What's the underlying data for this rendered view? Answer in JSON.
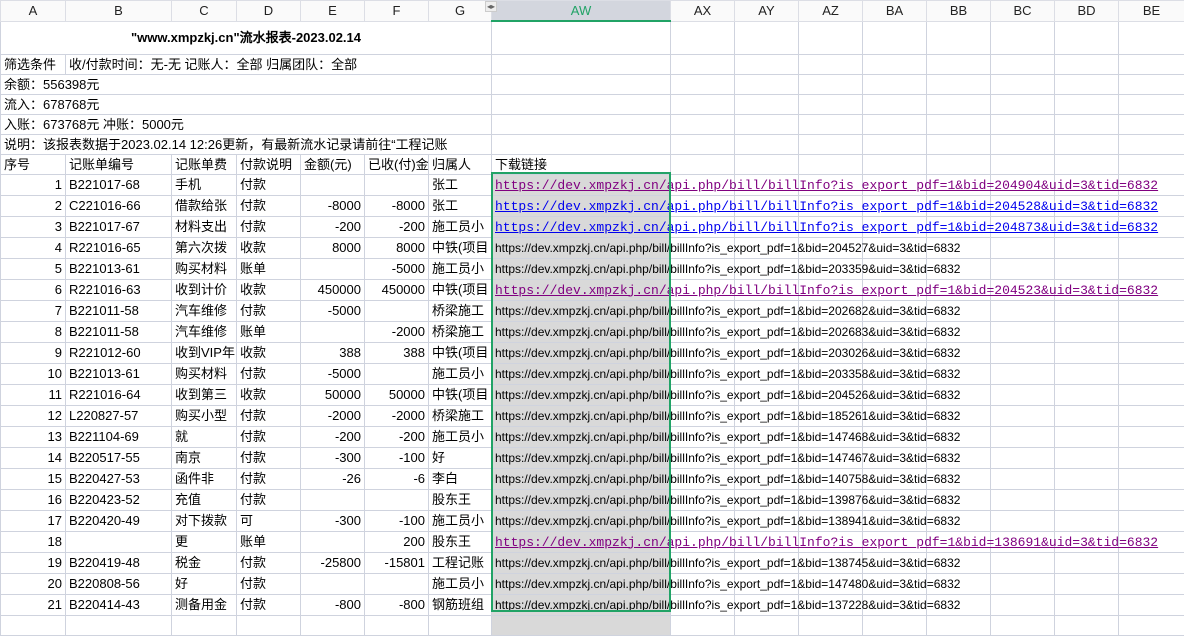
{
  "columns": [
    "A",
    "B",
    "C",
    "D",
    "E",
    "F",
    "G",
    "AW",
    "AX",
    "AY",
    "AZ",
    "BA",
    "BB",
    "BC",
    "BD",
    "BE"
  ],
  "selected_column": "AW",
  "title": "\"www.xmpzkj.cn\"流水报表-2023.02.14",
  "filter_label": "筛选条件",
  "filter_text": "收/付款时间：无-无      记账人：全部     归属团队：全部",
  "balance": "余额：556398元",
  "inflow": "流入：678768元",
  "posted": "入账：673768元      冲账：5000元",
  "note": "说明：该报表数据于2023.02.14 12:26更新，有最新流水记录请前往“工程记账",
  "headers": [
    "序号",
    "记账单编号",
    "记账单费",
    "付款说明",
    "金额(元)",
    "已收(付)金",
    "归属人",
    "下载链接"
  ],
  "url_prefix": "https://dev.xmpzkj.cn/api.php/bill/billInfo?is_export_pdf=1&bid=",
  "rows": [
    {
      "no": "1",
      "code": "B221017-68",
      "item": "手机",
      "desc": "付款",
      "amount": "",
      "paid": "",
      "owner": "张工",
      "url": "https://dev.xmpzkj.cn/api.php/bill/billInfo?is_export_pdf=1&bid=204904&uid=3&tid=6832",
      "link": "visited"
    },
    {
      "no": "2",
      "code": "C221016-66",
      "item": "借款给张",
      "desc": "付款",
      "amount": "-8000",
      "paid": "-8000",
      "owner": "张工",
      "url": "https://dev.xmpzkj.cn/api.php/bill/billInfo?is_export_pdf=1&bid=204528&uid=3&tid=6832",
      "link": "unvisited"
    },
    {
      "no": "3",
      "code": "B221017-67",
      "item": "材料支出",
      "desc": "付款",
      "amount": "-200",
      "paid": "-200",
      "owner": "施工员小",
      "url": "https://dev.xmpzkj.cn/api.php/bill/billInfo?is_export_pdf=1&bid=204873&uid=3&tid=6832",
      "link": "unvisited"
    },
    {
      "no": "4",
      "code": "R221016-65",
      "item": "第六次拨",
      "desc": "收款",
      "amount": "8000",
      "paid": "8000",
      "owner": "中铁(项目",
      "url": "https://dev.xmpzkj.cn/api.php/bill/billInfo?is_export_pdf=1&bid=204527&uid=3&tid=6832",
      "link": "none"
    },
    {
      "no": "5",
      "code": "B221013-61",
      "item": "购买材料",
      "desc": "账单",
      "amount": "",
      "paid": "-5000",
      "owner": "施工员小",
      "url": "https://dev.xmpzkj.cn/api.php/bill/billInfo?is_export_pdf=1&bid=203359&uid=3&tid=6832",
      "link": "none"
    },
    {
      "no": "6",
      "code": "R221016-63",
      "item": "收到计价",
      "desc": "收款",
      "amount": "450000",
      "paid": "450000",
      "owner": "中铁(项目",
      "url": "https://dev.xmpzkj.cn/api.php/bill/billInfo?is_export_pdf=1&bid=204523&uid=3&tid=6832",
      "link": "visited"
    },
    {
      "no": "7",
      "code": "B221011-58",
      "item": "汽车维修",
      "desc": "付款",
      "amount": "-5000",
      "paid": "",
      "owner": "桥梁施工",
      "url": "https://dev.xmpzkj.cn/api.php/bill/billInfo?is_export_pdf=1&bid=202682&uid=3&tid=6832",
      "link": "none"
    },
    {
      "no": "8",
      "code": "B221011-58",
      "item": "汽车维修",
      "desc": "账单",
      "amount": "",
      "paid": "-2000",
      "owner": "桥梁施工",
      "url": "https://dev.xmpzkj.cn/api.php/bill/billInfo?is_export_pdf=1&bid=202683&uid=3&tid=6832",
      "link": "none"
    },
    {
      "no": "9",
      "code": "R221012-60",
      "item": "收到VIP年",
      "desc": "收款",
      "amount": "388",
      "paid": "388",
      "owner": "中铁(项目",
      "url": "https://dev.xmpzkj.cn/api.php/bill/billInfo?is_export_pdf=1&bid=203026&uid=3&tid=6832",
      "link": "none"
    },
    {
      "no": "10",
      "code": "B221013-61",
      "item": "购买材料",
      "desc": "付款",
      "amount": "-5000",
      "paid": "",
      "owner": "施工员小",
      "url": "https://dev.xmpzkj.cn/api.php/bill/billInfo?is_export_pdf=1&bid=203358&uid=3&tid=6832",
      "link": "none"
    },
    {
      "no": "11",
      "code": "R221016-64",
      "item": "收到第三",
      "desc": "收款",
      "amount": "50000",
      "paid": "50000",
      "owner": "中铁(项目",
      "url": "https://dev.xmpzkj.cn/api.php/bill/billInfo?is_export_pdf=1&bid=204526&uid=3&tid=6832",
      "link": "none"
    },
    {
      "no": "12",
      "code": "L220827-57",
      "item": "购买小型",
      "desc": "付款",
      "amount": "-2000",
      "paid": "-2000",
      "owner": "桥梁施工",
      "url": "https://dev.xmpzkj.cn/api.php/bill/billInfo?is_export_pdf=1&bid=185261&uid=3&tid=6832",
      "link": "none"
    },
    {
      "no": "13",
      "code": "B221104-69",
      "item": "就",
      "desc": "付款",
      "amount": "-200",
      "paid": "-200",
      "owner": "施工员小",
      "url": "https://dev.xmpzkj.cn/api.php/bill/billInfo?is_export_pdf=1&bid=147468&uid=3&tid=6832",
      "link": "none"
    },
    {
      "no": "14",
      "code": "B220517-55",
      "item": "南京",
      "desc": "付款",
      "amount": "-300",
      "paid": "-100",
      "owner": "好",
      "url": "https://dev.xmpzkj.cn/api.php/bill/billInfo?is_export_pdf=1&bid=147467&uid=3&tid=6832",
      "link": "none"
    },
    {
      "no": "15",
      "code": "B220427-53",
      "item": "函件非",
      "desc": "付款",
      "amount": "-26",
      "paid": "-6",
      "owner": "李白",
      "url": "https://dev.xmpzkj.cn/api.php/bill/billInfo?is_export_pdf=1&bid=140758&uid=3&tid=6832",
      "link": "none"
    },
    {
      "no": "16",
      "code": "B220423-52",
      "item": "充值",
      "desc": "付款",
      "amount": "",
      "paid": "",
      "owner": "股东王",
      "url": "https://dev.xmpzkj.cn/api.php/bill/billInfo?is_export_pdf=1&bid=139876&uid=3&tid=6832",
      "link": "none"
    },
    {
      "no": "17",
      "code": "B220420-49",
      "item": "对下拨款",
      "desc": "可",
      "amount": "-300",
      "paid": "-100",
      "owner": "施工员小",
      "url": "https://dev.xmpzkj.cn/api.php/bill/billInfo?is_export_pdf=1&bid=138941&uid=3&tid=6832",
      "link": "none"
    },
    {
      "no": "18",
      "code": "",
      "item": "更",
      "desc": "账单",
      "amount": "",
      "paid": "200",
      "owner": "股东王",
      "url": "https://dev.xmpzkj.cn/api.php/bill/billInfo?is_export_pdf=1&bid=138691&uid=3&tid=6832",
      "link": "visited"
    },
    {
      "no": "19",
      "code": "B220419-48",
      "item": "税金",
      "desc": "付款",
      "amount": "-25800",
      "paid": "-15801",
      "owner": "工程记账",
      "url": "https://dev.xmpzkj.cn/api.php/bill/billInfo?is_export_pdf=1&bid=138745&uid=3&tid=6832",
      "link": "none"
    },
    {
      "no": "20",
      "code": "B220808-56",
      "item": "好",
      "desc": "付款",
      "amount": "",
      "paid": "",
      "owner": "施工员小",
      "url": "https://dev.xmpzkj.cn/api.php/bill/billInfo?is_export_pdf=1&bid=147480&uid=3&tid=6832",
      "link": "none"
    },
    {
      "no": "21",
      "code": "B220414-43",
      "item": "测备用金",
      "desc": "付款",
      "amount": "-800",
      "paid": "-800",
      "owner": "钢筋班组",
      "url": "https://dev.xmpzkj.cn/api.php/bill/billInfo?is_export_pdf=1&bid=137228&uid=3&tid=6832",
      "link": "none"
    }
  ]
}
